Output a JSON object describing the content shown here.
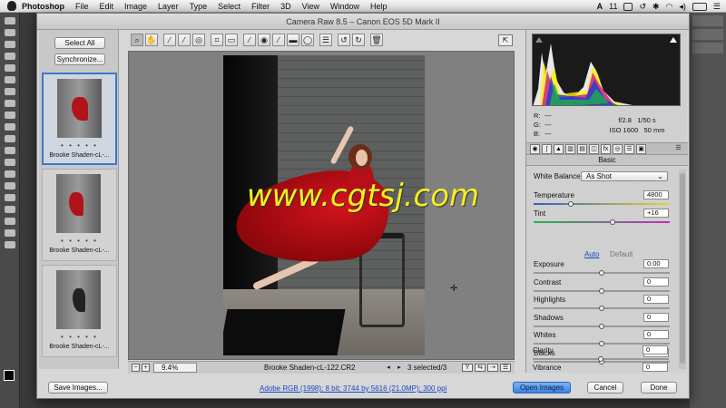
{
  "menubar": {
    "app": "Photoshop",
    "items": [
      "File",
      "Edit",
      "Image",
      "Layer",
      "Type",
      "Select",
      "Filter",
      "3D",
      "View",
      "Window",
      "Help"
    ],
    "adobe_badge": "11"
  },
  "dialog": {
    "title": "Camera Raw 8.5  –  Canon EOS 5D Mark II"
  },
  "filmstrip": {
    "select_all": "Select All",
    "synchronize": "Synchronize...",
    "thumbnails": [
      {
        "caption": "Brooke Shaden-cL-...",
        "rating": "• • • • •",
        "selected": true
      },
      {
        "caption": "Brooke Shaden-cL-...",
        "rating": "• • • • •",
        "selected": false
      },
      {
        "caption": "Brooke Shaden-cL-...",
        "rating": "• • • • •",
        "selected": false
      }
    ]
  },
  "statusbar": {
    "zoom": "9.4%",
    "filename": "Brooke Shaden-cL-122.CR2",
    "selection": "3 selected/3"
  },
  "watermark": "www.cgtsj.com",
  "readout": {
    "r_label": "R:",
    "g_label": "G:",
    "b_label": "B:",
    "dashes": "---",
    "aperture": "f/2.8",
    "shutter": "1/50 s",
    "iso": "ISO 1600",
    "focal": "50 mm"
  },
  "basic_panel": {
    "title": "Basic",
    "white_balance_label": "White Balance:",
    "white_balance_value": "As Shot",
    "auto": "Auto",
    "default": "Default",
    "sliders": [
      {
        "label": "Temperature",
        "value": "4800",
        "position": 0.27
      },
      {
        "label": "Tint",
        "value": "+16",
        "position": 0.58
      },
      {
        "label": "Exposure",
        "value": "0.00",
        "position": 0.5
      },
      {
        "label": "Contrast",
        "value": "0",
        "position": 0.5
      },
      {
        "label": "Highlights",
        "value": "0",
        "position": 0.5
      },
      {
        "label": "Shadows",
        "value": "0",
        "position": 0.5
      },
      {
        "label": "Whites",
        "value": "0",
        "position": 0.5
      },
      {
        "label": "Blacks",
        "value": "0",
        "position": 0.5
      },
      {
        "label": "Clarity",
        "value": "0",
        "position": 0.5
      },
      {
        "label": "Vibrance",
        "value": "0",
        "position": 0.5
      }
    ]
  },
  "bottom": {
    "save_images": "Save Images...",
    "workflow_link": "Adobe RGB (1998); 8 bit; 3744 by 5616 (21.0MP); 300 ppi",
    "open_images": "Open Images",
    "cancel": "Cancel",
    "done": "Done"
  },
  "colors": {
    "accent": "#3a83e2",
    "dress": "#b0141a",
    "watermark": "#f4ef1e"
  }
}
